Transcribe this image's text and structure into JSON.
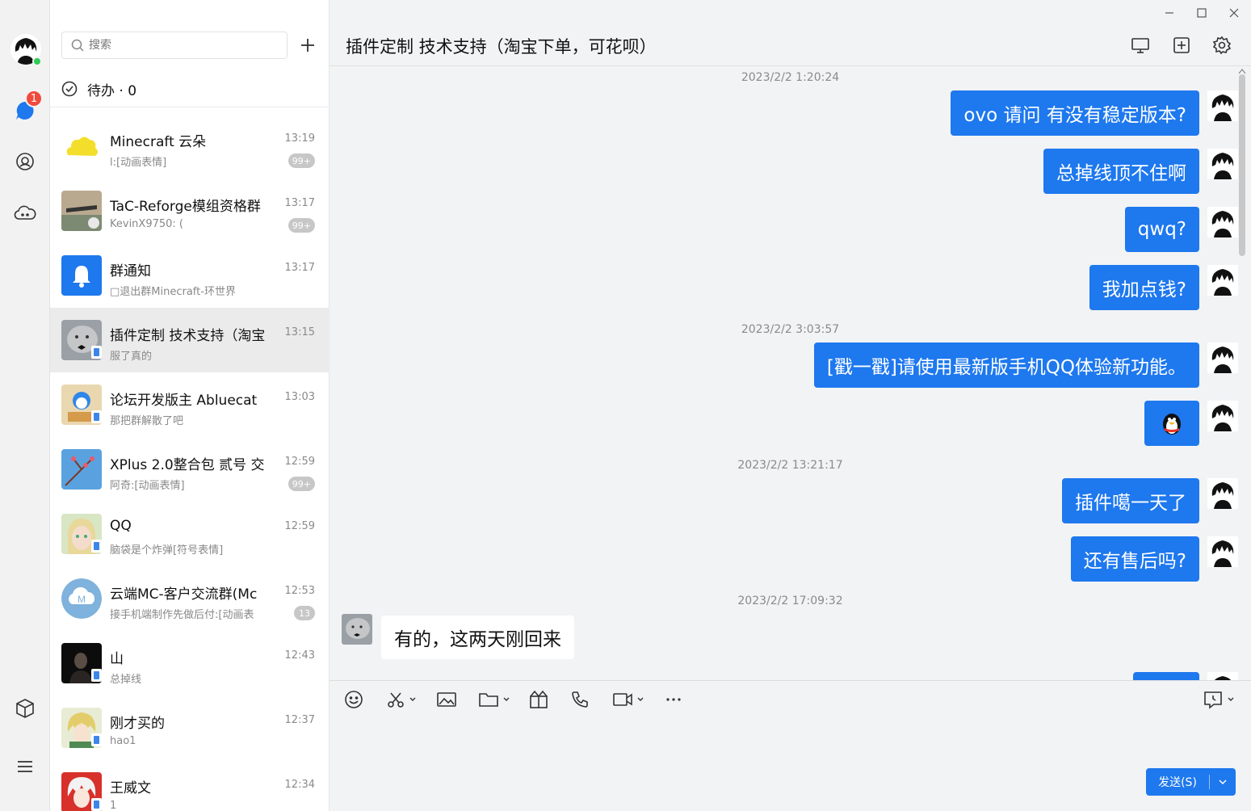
{
  "colors": {
    "accent": "#1e78ee",
    "badge": "#f04a3b",
    "online": "#2ecc55"
  },
  "rail": {
    "unread_badge": "1",
    "icons": [
      "chat-icon",
      "contacts-icon",
      "cloud-icon",
      "app-box-icon",
      "menu-icon"
    ]
  },
  "search": {
    "placeholder": "搜索"
  },
  "todo": {
    "label": "待办 · 0"
  },
  "conversations": [
    {
      "name": "Minecraft 云朵",
      "last_message": "l:[动画表情]",
      "time": "13:19",
      "unread": "99+"
    },
    {
      "name": "TaC-Reforge模组资格群",
      "last_message": "KevinX9750: (",
      "time": "13:17",
      "unread": "99+"
    },
    {
      "name": "群通知",
      "last_message": "□退出群Minecraft-环世界",
      "time": "13:17",
      "unread": ""
    },
    {
      "name": "插件定制 技术支持（淘宝",
      "last_message": "服了真的",
      "time": "13:15",
      "unread": ""
    },
    {
      "name": "论坛开发版主 Abluecat",
      "last_message": "那把群解散了吧",
      "time": "13:03",
      "unread": ""
    },
    {
      "name": "XPlus 2.0整合包 贰号 交",
      "last_message": "阿奇:[动画表情]",
      "time": "12:59",
      "unread": "99+"
    },
    {
      "name": "QQ",
      "last_message": "脑袋是个炸弹[符号表情]",
      "time": "12:59",
      "unread": ""
    },
    {
      "name": "云端MC-客户交流群(Mc",
      "last_message": "接手机端制作先做后付:[动画表",
      "time": "12:53",
      "unread": "13"
    },
    {
      "name": "山",
      "last_message": "总掉线",
      "time": "12:43",
      "unread": ""
    },
    {
      "name": "刚才买的",
      "last_message": "hao1",
      "time": "12:37",
      "unread": ""
    },
    {
      "name": "王威文",
      "last_message": "1",
      "time": "12:34",
      "unread": ""
    }
  ],
  "chat": {
    "title": "插件定制 技术支持（淘宝下单，可花呗）",
    "messages": {
      "ts1": "2023/2/2 1:20:24",
      "m1": "ovo 请问 有没有稳定版本?",
      "m2": "总掉线顶不住啊",
      "m3": "qwq?",
      "m4": "我加点钱?",
      "ts2": "2023/2/2 3:03:57",
      "m5": "[戳一戳]请使用最新版手机QQ体验新功能。",
      "ts3": "2023/2/2 13:21:17",
      "m7": "插件噶一天了",
      "m8": "还有售后吗?",
      "ts4": "2023/2/2 17:09:32",
      "m9": "有的，这两天刚回来"
    }
  },
  "composer": {
    "send_label": "发送(S)"
  }
}
